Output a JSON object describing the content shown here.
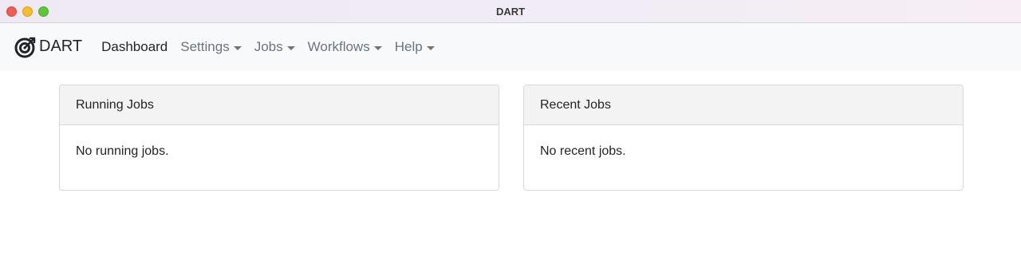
{
  "window": {
    "title": "DART"
  },
  "navbar": {
    "brand": "DART",
    "brand_icon": "target-icon",
    "items": [
      {
        "label": "Dashboard",
        "active": true,
        "dropdown": false
      },
      {
        "label": "Settings",
        "active": false,
        "dropdown": true
      },
      {
        "label": "Jobs",
        "active": false,
        "dropdown": true
      },
      {
        "label": "Workflows",
        "active": false,
        "dropdown": true
      },
      {
        "label": "Help",
        "active": false,
        "dropdown": true
      }
    ]
  },
  "cards": {
    "running": {
      "header": "Running Jobs",
      "body": "No running jobs."
    },
    "recent": {
      "header": "Recent Jobs",
      "body": "No recent jobs."
    }
  },
  "colors": {
    "navbar_bg": "#f8f9fa",
    "card_header_bg": "#f3f3f3",
    "nav_muted": "#6c757d",
    "nav_active": "#212529"
  }
}
